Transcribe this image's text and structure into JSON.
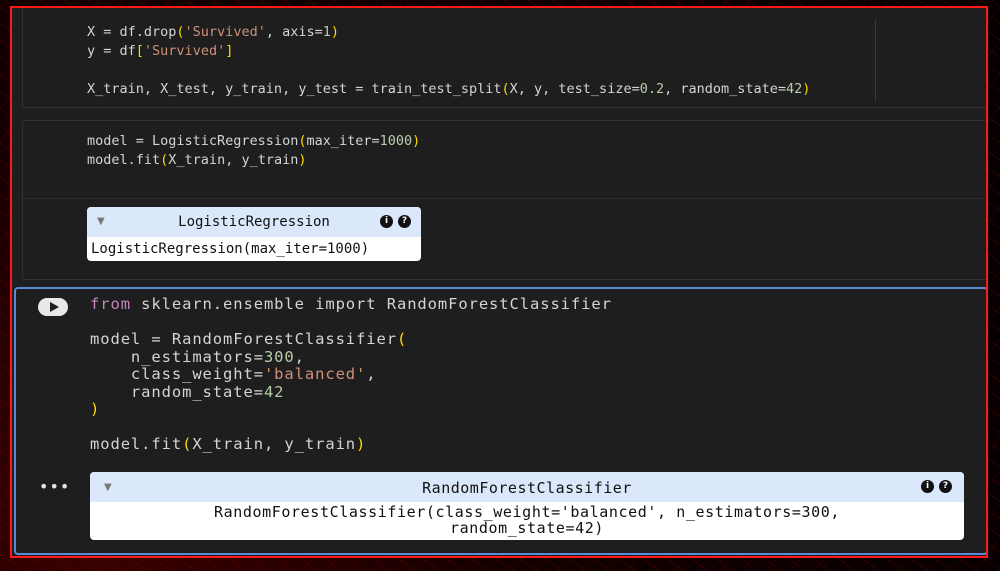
{
  "cells": [
    {
      "lines": [
        "X = df.drop('Survived', axis=1)",
        "y = df['Survived']",
        "",
        "X_train, X_test, y_train, y_test = train_test_split(X, y, test_size=0.2, random_state=42)"
      ]
    },
    {
      "lines": [
        "model = LogisticRegression(max_iter=1000)",
        "model.fit(X_train, y_train)"
      ],
      "output": {
        "estimator_name": "LogisticRegression",
        "estimator_repr": "LogisticRegression(max_iter=1000)",
        "info_icon": "info-icon",
        "help_icon": "help-icon"
      }
    },
    {
      "lines": [
        "from sklearn.ensemble import RandomForestClassifier",
        "",
        "model = RandomForestClassifier(",
        "    n_estimators=300,",
        "    class_weight='balanced',",
        "    random_state=42",
        ")",
        "",
        "model.fit(X_train, y_train)"
      ],
      "more_label": "•••",
      "output": {
        "estimator_name": "RandomForestClassifier",
        "estimator_repr_line1": "RandomForestClassifier(class_weight='balanced', n_estimators=300,",
        "estimator_repr_line2": "random_state=42)",
        "info_icon": "info-icon",
        "help_icon": "help-icon"
      }
    }
  ],
  "colors": {
    "frame_border": "#ff1a1a",
    "active_cell_border": "#5a88d6",
    "string": "#ce9178",
    "keyword": "#c586c0",
    "number": "#b5cea8",
    "bracket": "#ffd700",
    "estimator_header": "#dbe8fb"
  }
}
